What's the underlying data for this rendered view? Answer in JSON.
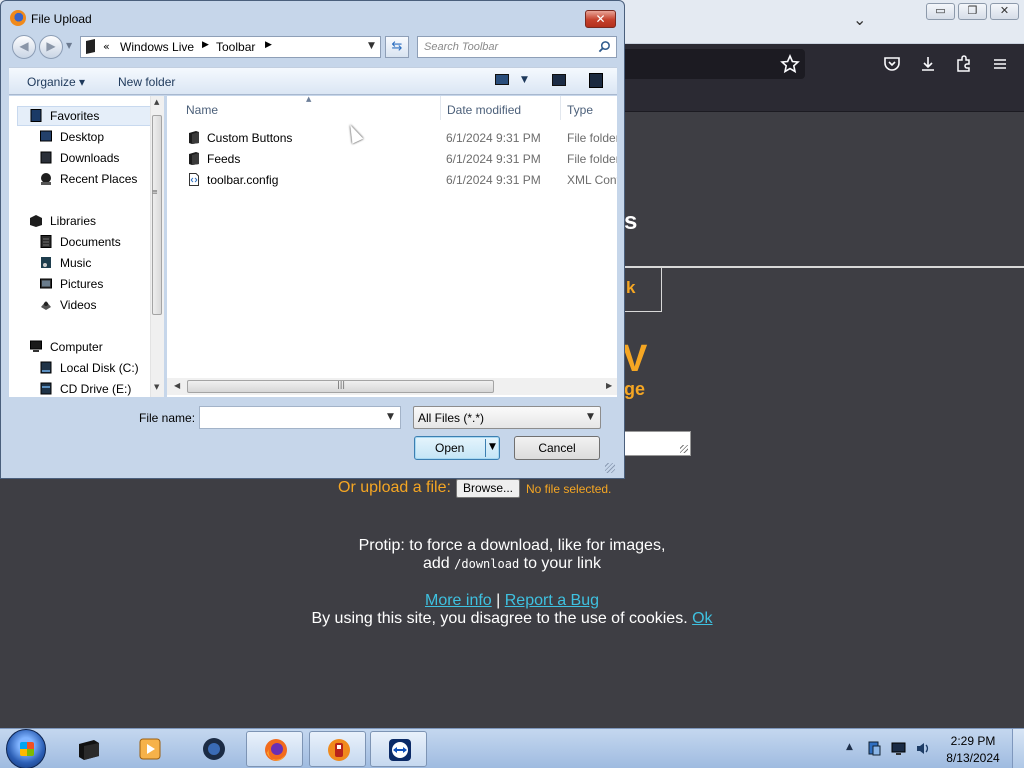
{
  "browser": {
    "window_controls": {
      "minimize": "▭",
      "restore": "❐",
      "close": "✕"
    },
    "tabs_chevron": "⌄",
    "toolbar_icons": [
      "star-icon",
      "pocket-icon",
      "download-icon",
      "extensions-icon",
      "menu-icon"
    ],
    "page": {
      "heading_fragment": "s",
      "box_fragment": "k",
      "big_fragment": "V",
      "sub_fragment": "ge",
      "upload_label": "Or upload a file:",
      "browse_label": "Browse...",
      "no_file": "No file selected.",
      "protip_line1": "Protip: to force a download, like for images,",
      "protip_add": "add ",
      "protip_code": "/download",
      "protip_end": " to your link",
      "more_info": "More info",
      "separator": " | ",
      "report_bug": "Report a Bug",
      "cookie_text": "By using this site, you disagree to the use of cookies. ",
      "cookie_ok": "Ok"
    },
    "colors": {
      "accent": "#f5a623",
      "link": "#3ec1e0",
      "background": "#3e3e44"
    }
  },
  "dialog": {
    "title": "File Upload",
    "close_glyph": "✕",
    "back_glyph": "◀",
    "forward_glyph": "▶",
    "recent_glyph": "▼",
    "address": {
      "overflow": "«",
      "crumbs": [
        "Windows Live",
        "Toolbar"
      ],
      "sep": "▶",
      "dropdown": "▼"
    },
    "refresh_glyph": "⇆",
    "search_placeholder": "Search Toolbar",
    "command_bar": {
      "organize": "Organize ▾",
      "new_folder": "New folder",
      "views_drop": "▼"
    },
    "nav": {
      "favorites": {
        "label": "Favorites",
        "items": [
          "Desktop",
          "Downloads",
          "Recent Places"
        ]
      },
      "libraries": {
        "label": "Libraries",
        "items": [
          "Documents",
          "Music",
          "Pictures",
          "Videos"
        ]
      },
      "computer": {
        "label": "Computer",
        "items": [
          "Local Disk (C:)",
          "CD Drive (E:)"
        ]
      }
    },
    "scroll_glyphs": {
      "up": "▲",
      "down": "▼",
      "left": "◀",
      "right": "▶",
      "grip": "≡",
      "hgrip": "|||"
    },
    "columns": {
      "name": "Name",
      "date": "Date modified",
      "type": "Type",
      "sort": "▲"
    },
    "files": [
      {
        "name": "Custom Buttons",
        "date": "6/1/2024 9:31 PM",
        "type": "File folder",
        "icon": "folder-icon"
      },
      {
        "name": "Feeds",
        "date": "6/1/2024 9:31 PM",
        "type": "File folder",
        "icon": "folder-icon"
      },
      {
        "name": "toolbar.config",
        "date": "6/1/2024 9:31 PM",
        "type": "XML Conf",
        "icon": "xml-file-icon"
      }
    ],
    "file_name_label": "File name:",
    "file_name_value": "",
    "file_name_drop": "▼",
    "file_type": "All Files (*.*)",
    "file_type_drop": "▼",
    "open_label": "Open",
    "open_drop": "▼",
    "cancel_label": "Cancel"
  },
  "taskbar": {
    "apps": [
      "cmd-icon",
      "media-player-icon",
      "firefox-dark-icon",
      "firefox-icon",
      "paint-icon",
      "teamviewer-icon"
    ],
    "tray_up": "▲",
    "tray_icons": [
      "network-icon",
      "display-icon",
      "volume-icon"
    ],
    "time": "2:29 PM",
    "date": "8/13/2024"
  }
}
